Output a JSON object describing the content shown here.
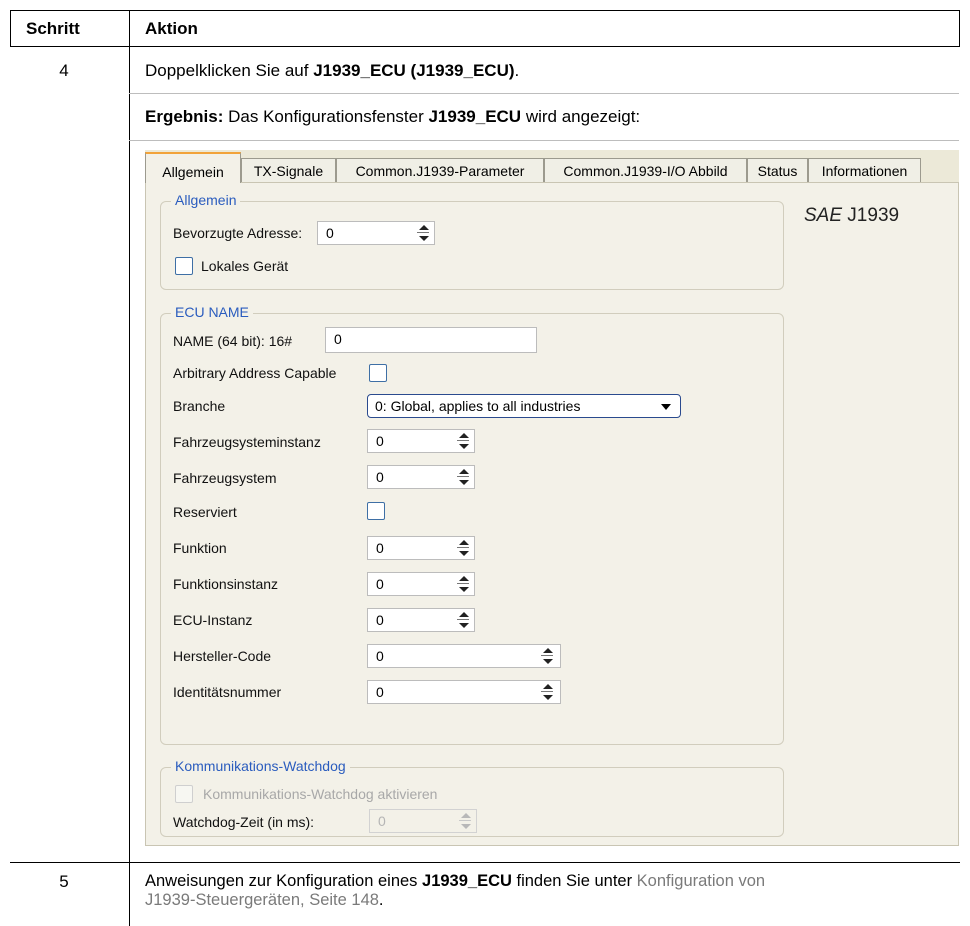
{
  "table": {
    "header": {
      "step": "Schritt",
      "action": "Aktion"
    },
    "row1": {
      "step": "4",
      "line1_prefix": "Doppelklicken Sie auf ",
      "line1_bold": "J1939_ECU (J1939_ECU)",
      "line1_suffix": ".",
      "result_bold": "Ergebnis:",
      "result_text_a": " Das Konfigurationsfenster ",
      "result_bold2": "J1939_ECU",
      "result_text_b": " wird angezeigt:"
    },
    "row2": {
      "step": "5",
      "text_a": "Anweisungen zur Konfiguration eines ",
      "bold": "J1939_ECU",
      "text_b": " finden Sie unter ",
      "link_line1": "Konfiguration von",
      "link_line2": "J1939-Steuergeräten, Seite 148",
      "text_c": "."
    }
  },
  "dialog": {
    "tabs": [
      "Allgemein",
      "TX-Signale",
      "Common.J1939-Parameter",
      "Common.J1939-I/O Abbild",
      "Status",
      "Informationen"
    ],
    "active_tab": "Allgemein",
    "sae_prefix": "SAE",
    "sae_suffix": " J1939",
    "general": {
      "title": "Allgemein",
      "preferred_address_label": "Bevorzugte Adresse:",
      "preferred_address_value": "0",
      "local_device_label": "Lokales Gerät",
      "local_device_checked": false
    },
    "ecu_name": {
      "title": "ECU NAME",
      "name_label": "NAME (64 bit): 16#",
      "name_value": "0",
      "arbitrary_label": "Arbitrary Address Capable",
      "arbitrary_checked": false,
      "industry_label": "Branche",
      "industry_value": "0: Global, applies to all industries",
      "vehicle_system_instance_label": "Fahrzeugsysteminstanz",
      "vehicle_system_instance_value": "0",
      "vehicle_system_label": "Fahrzeugsystem",
      "vehicle_system_value": "0",
      "reserved_label": "Reserviert",
      "reserved_checked": false,
      "function_label": "Funktion",
      "function_value": "0",
      "function_instance_label": "Funktionsinstanz",
      "function_instance_value": "0",
      "ecu_instance_label": "ECU-Instanz",
      "ecu_instance_value": "0",
      "manufacturer_label": "Hersteller-Code",
      "manufacturer_value": "0",
      "identity_label": "Identitätsnummer",
      "identity_value": "0"
    },
    "watchdog": {
      "title": "Kommunikations-Watchdog",
      "enable_label": "Kommunikations-Watchdog aktivieren",
      "enable_checked": false,
      "time_label": "Watchdog-Zeit (in ms):",
      "time_value": "0"
    }
  },
  "colors": {
    "group_title": "#2a5cbe",
    "active_tab_accent": "#f2a33a",
    "link": "#7a7a7a"
  }
}
